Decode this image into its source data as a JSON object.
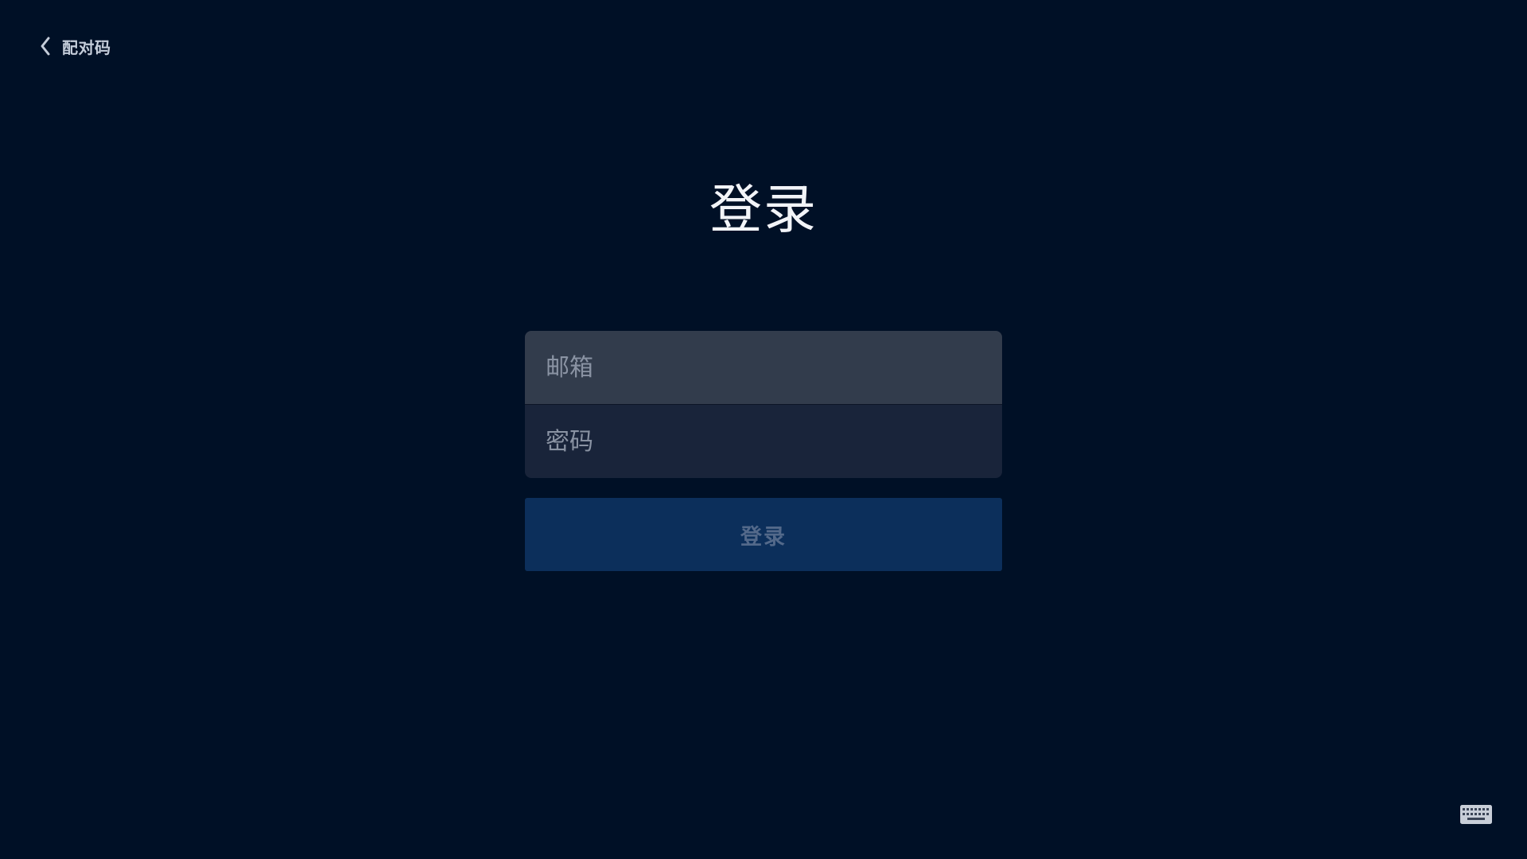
{
  "header": {
    "back_label": "配对码",
    "back_icon": "chevron-left-icon"
  },
  "login": {
    "title": "登录",
    "email_placeholder": "邮箱",
    "email_value": "",
    "password_placeholder": "密码",
    "password_value": "",
    "submit_label": "登录"
  },
  "footer": {
    "keyboard_icon": "keyboard-icon"
  },
  "colors": {
    "background": "#001026",
    "email_field": "#323c4c",
    "password_field": "#19243a",
    "submit_button": "#0c2f5b",
    "submit_text": "#53698a",
    "title_text": "#f2f4f8"
  }
}
